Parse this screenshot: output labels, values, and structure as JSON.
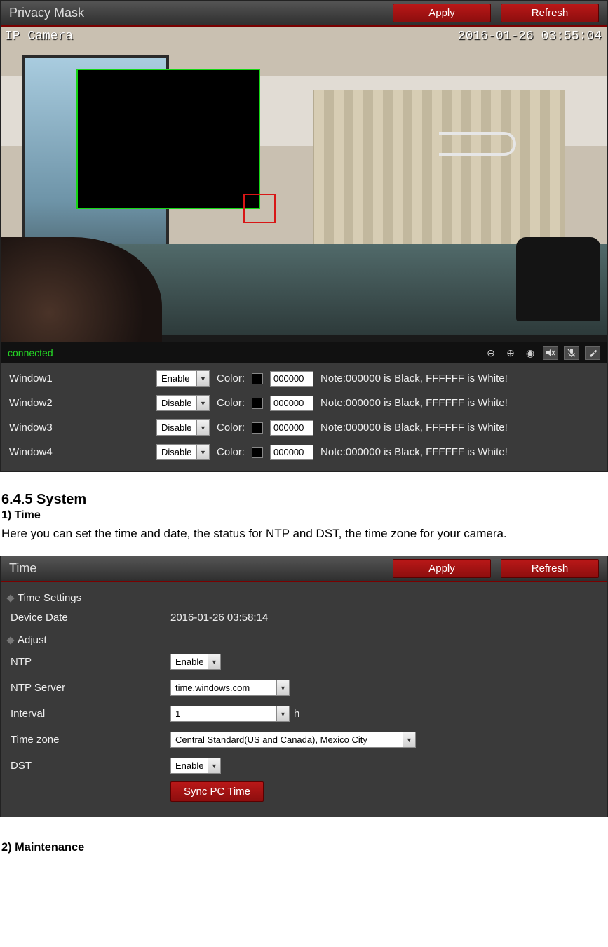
{
  "privacy_panel": {
    "title": "Privacy Mask",
    "apply": "Apply",
    "refresh": "Refresh",
    "overlay_name": "IP Camera",
    "overlay_time": "2016-01-26 03:55:04",
    "status": "connected",
    "color_label": "Color:",
    "note_text": "Note:000000 is Black, FFFFFF is White!",
    "windows": [
      {
        "label": "Window1",
        "state": "Enable",
        "color": "000000"
      },
      {
        "label": "Window2",
        "state": "Disable",
        "color": "000000"
      },
      {
        "label": "Window3",
        "state": "Disable",
        "color": "000000"
      },
      {
        "label": "Window4",
        "state": "Disable",
        "color": "000000"
      }
    ]
  },
  "doc": {
    "h_system": "6.4.5 System",
    "h_time": "1) Time",
    "p_time": "Here you can set the time and date, the status for NTP and DST, the time zone for your camera.",
    "h_maint": "2) Maintenance"
  },
  "time_panel": {
    "title": "Time",
    "apply": "Apply",
    "refresh": "Refresh",
    "section_settings": "Time Settings",
    "section_adjust": "Adjust",
    "device_date_label": "Device Date",
    "device_date_value": "2016-01-26 03:58:14",
    "ntp_label": "NTP",
    "ntp_value": "Enable",
    "ntp_server_label": "NTP Server",
    "ntp_server_value": "time.windows.com",
    "interval_label": "Interval",
    "interval_value": "1",
    "interval_unit": "h",
    "tz_label": "Time zone",
    "tz_value": "Central Standard(US and Canada), Mexico City",
    "dst_label": "DST",
    "dst_value": "Enable",
    "sync_label": "Sync PC Time"
  }
}
